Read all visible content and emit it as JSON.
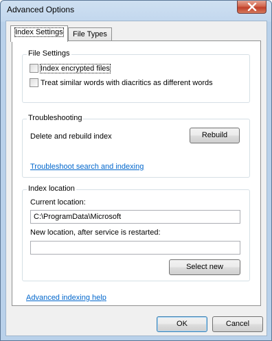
{
  "window": {
    "title": "Advanced Options"
  },
  "tabs": [
    {
      "label": "Index Settings",
      "active": true
    },
    {
      "label": "File Types",
      "active": false
    }
  ],
  "file_settings": {
    "title": "File Settings",
    "options": [
      {
        "label": "Index encrypted files",
        "checked": false
      },
      {
        "label": "Treat similar words with diacritics as different words",
        "checked": false
      }
    ]
  },
  "troubleshooting": {
    "title": "Troubleshooting",
    "description": "Delete and rebuild index",
    "rebuild_label": "Rebuild",
    "link": "Troubleshoot search and indexing"
  },
  "index_location": {
    "title": "Index location",
    "current_label": "Current location:",
    "current_value": "C:\\ProgramData\\Microsoft",
    "new_label": "New location, after service is restarted:",
    "new_value": "",
    "select_new_label": "Select new"
  },
  "help_link": "Advanced indexing help",
  "footer": {
    "ok_label": "OK",
    "cancel_label": "Cancel"
  }
}
